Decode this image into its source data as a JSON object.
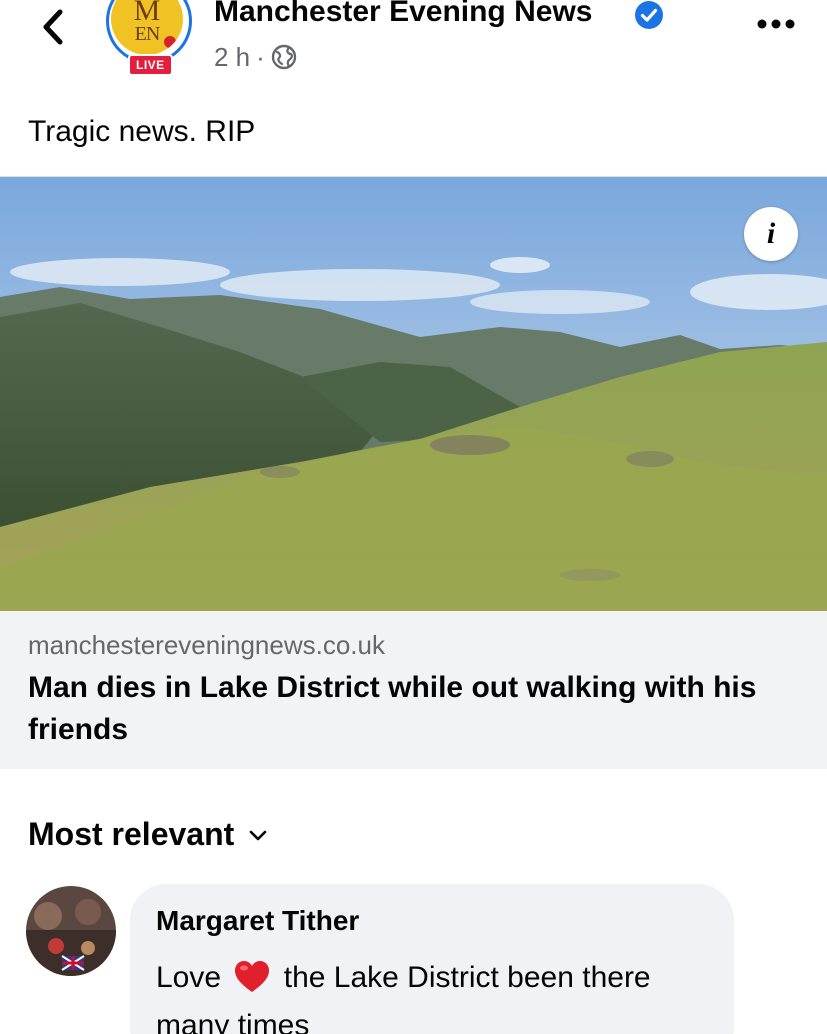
{
  "header": {
    "back_icon": "chevron-left-icon",
    "page_name": "Manchester Evening News",
    "logo_line1": "M",
    "logo_line2": "EN",
    "live_badge": "LIVE",
    "timestamp": "2 h",
    "separator": "·",
    "audience_icon": "globe-icon",
    "verified_icon": "verified-badge-icon",
    "more_icon": "more-horizontal-icon"
  },
  "post": {
    "caption": "Tragic news. RIP"
  },
  "link_card": {
    "image_alt": "Lake District fells landscape",
    "info_label": "i",
    "domain": "manchestereveningnews.co.uk",
    "title": "Man dies in Lake District while out walking with his friends"
  },
  "comments_section": {
    "sort_label": "Most relevant",
    "sort_icon": "chevron-down-icon"
  },
  "comments": [
    {
      "author": "Margaret Tither",
      "text_before": "Love",
      "emoji_icon": "red-heart-emoji",
      "text_after": "the Lake District been there many times"
    }
  ],
  "colors": {
    "verified_blue": "#1b74e4",
    "live_red": "#e41e3f",
    "secondary_text": "#65676b",
    "link_meta_bg": "#f2f3f5",
    "comment_bubble_bg": "#f0f2f5"
  }
}
